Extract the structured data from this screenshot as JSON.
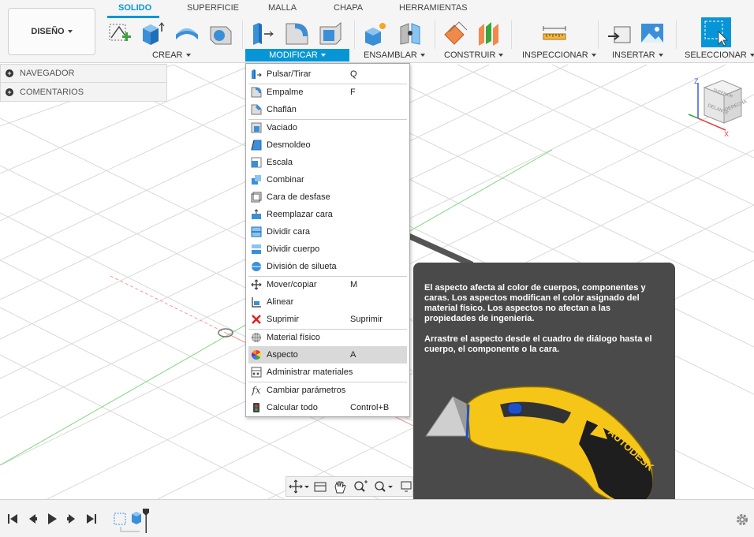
{
  "workspace": {
    "label": "DISEÑO"
  },
  "tabs": [
    {
      "label": "SOLIDO",
      "active": true
    },
    {
      "label": "SUPERFICIE",
      "active": false
    },
    {
      "label": "MALLA",
      "active": false
    },
    {
      "label": "CHAPA",
      "active": false
    },
    {
      "label": "HERRAMIENTAS",
      "active": false
    }
  ],
  "groups": {
    "crear": "CREAR",
    "modificar": "MODIFICAR",
    "ensamblar": "ENSAMBLAR",
    "construir": "CONSTRUIR",
    "inspeccionar": "INSPECCIONAR",
    "insertar": "INSERTAR",
    "seleccionar": "SELECCIONAR"
  },
  "browser": {
    "navegador": "NAVEGADOR",
    "comentarios": "COMENTARIOS"
  },
  "modify_menu": [
    {
      "label": "Pulsar/Tirar",
      "shortcut": "Q",
      "icon": "press-pull-icon"
    },
    {
      "label": "Empalme",
      "shortcut": "F",
      "icon": "fillet-icon"
    },
    {
      "label": "Chaflán",
      "shortcut": "",
      "icon": "chamfer-icon"
    },
    {
      "label": "Vaciado",
      "shortcut": "",
      "icon": "shell-icon"
    },
    {
      "label": "Desmoldeo",
      "shortcut": "",
      "icon": "draft-icon"
    },
    {
      "label": "Escala",
      "shortcut": "",
      "icon": "scale-icon"
    },
    {
      "label": "Combinar",
      "shortcut": "",
      "icon": "combine-icon"
    },
    {
      "label": "Cara de desfase",
      "shortcut": "",
      "icon": "offset-face-icon"
    },
    {
      "label": "Reemplazar cara",
      "shortcut": "",
      "icon": "replace-face-icon"
    },
    {
      "label": "Dividir cara",
      "shortcut": "",
      "icon": "split-face-icon"
    },
    {
      "label": "Dividir cuerpo",
      "shortcut": "",
      "icon": "split-body-icon"
    },
    {
      "label": "División de silueta",
      "shortcut": "",
      "icon": "silhouette-split-icon"
    },
    {
      "label": "Mover/copiar",
      "shortcut": "M",
      "icon": "move-icon"
    },
    {
      "label": "Alinear",
      "shortcut": "",
      "icon": "align-icon"
    },
    {
      "label": "Suprimir",
      "shortcut": "Suprimir",
      "icon": "delete-icon"
    },
    {
      "label": "Material físico",
      "shortcut": "",
      "icon": "physical-material-icon"
    },
    {
      "label": "Aspecto",
      "shortcut": "A",
      "icon": "appearance-icon",
      "highlighted": true
    },
    {
      "label": "Administrar materiales",
      "shortcut": "",
      "icon": "manage-materials-icon"
    },
    {
      "label": "Cambiar parámetros",
      "shortcut": "",
      "icon": "fx-icon"
    },
    {
      "label": "Calcular todo",
      "shortcut": "Control+B",
      "icon": "compute-all-icon"
    }
  ],
  "tooltip": {
    "paragraph1": "El aspecto afecta al color de cuerpos, componentes y caras. Los aspectos modifican el color asignado del material físico. Los aspectos no afectan a las propiedades de ingeniería.",
    "paragraph2": "Arrastre el aspecto desde el cuadro de diálogo hasta el cuerpo, el componente o la cara.",
    "image_brand": "AUTODESK"
  },
  "viewcube": {
    "top": "SUPERIOR",
    "front": "DELANTE",
    "right": "DERECHA",
    "axis_z": "Z",
    "axis_x": "X"
  },
  "colors": {
    "accent": "#0696d7",
    "tooltip_bg": "#4a4a4a",
    "highlight": "#d9d9d9"
  }
}
